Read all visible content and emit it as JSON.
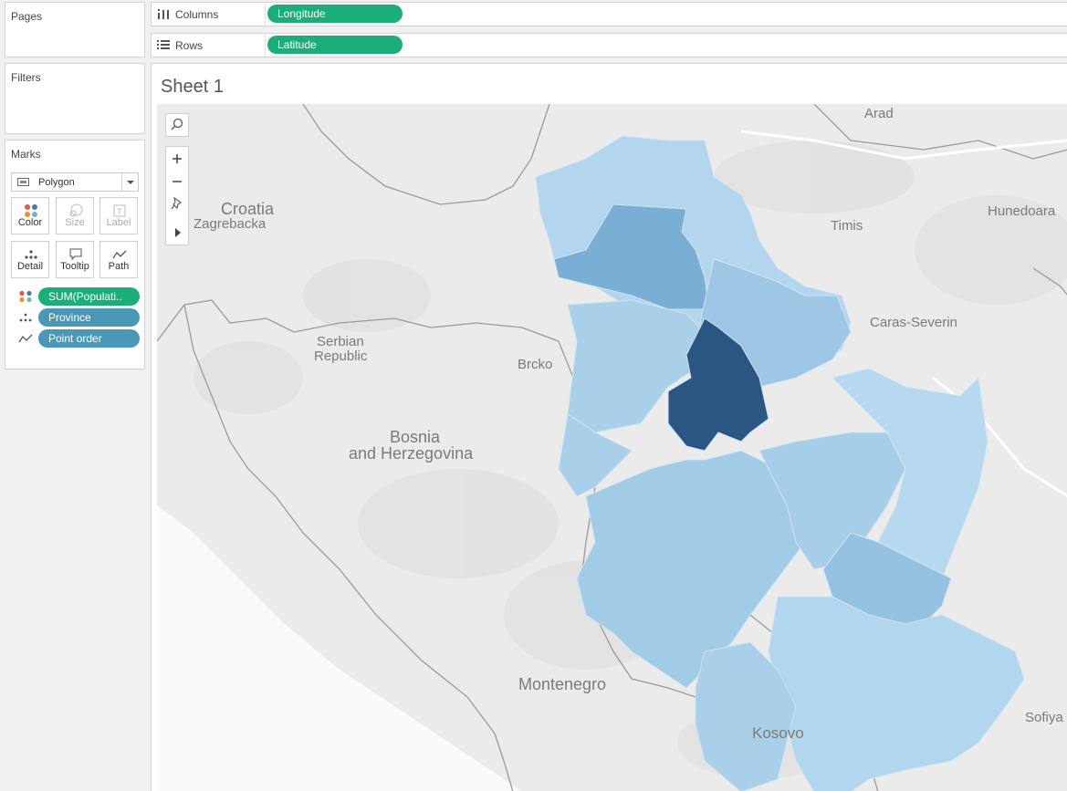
{
  "panels": {
    "pages": "Pages",
    "filters": "Filters",
    "marks": "Marks"
  },
  "marks": {
    "mark_type": "Polygon",
    "buttons": {
      "color": "Color",
      "size": "Size",
      "label": "Label",
      "detail": "Detail",
      "tooltip": "Tooltip",
      "path": "Path"
    },
    "pills": [
      {
        "label": "SUM(Populati..",
        "kind": "color"
      },
      {
        "label": "Province",
        "kind": "detail"
      },
      {
        "label": "Point order",
        "kind": "path"
      }
    ]
  },
  "shelves": {
    "columns": {
      "label": "Columns",
      "field": "Longitude"
    },
    "rows": {
      "label": "Rows",
      "field": "Latitude"
    }
  },
  "sheet": {
    "title": "Sheet 1",
    "map_labels": {
      "arad": "Arad",
      "croatia": "Croatia",
      "zagrebacka": "Zagrebacka",
      "timis": "Timis",
      "hunedoara": "Hunedoara",
      "caras": "Caras-Severin",
      "serbian1": "Serbian",
      "serbian2": "Republic",
      "brcko": "Brcko",
      "bosnia1": "Bosnia",
      "bosnia2": "and Herzegovina",
      "montenegro": "Montenegro",
      "kosovo": "Kosovo",
      "sofiya": "Sofiya"
    }
  },
  "colors": {
    "pill_green": "#1bae78",
    "pill_blue": "#4a97b8",
    "region_light": "#b5d7ee",
    "region_mid": "#9cc6e3",
    "region_dark": "#7aaed4",
    "region_darkest": "#2b5683"
  },
  "icons": [
    "columns-icon",
    "rows-icon",
    "search-icon",
    "zoom-in-icon",
    "zoom-out-icon",
    "pin-icon",
    "expand-icon",
    "polygon-icon",
    "color-icon",
    "size-icon",
    "label-icon",
    "detail-icon",
    "tooltip-icon",
    "path-icon"
  ]
}
